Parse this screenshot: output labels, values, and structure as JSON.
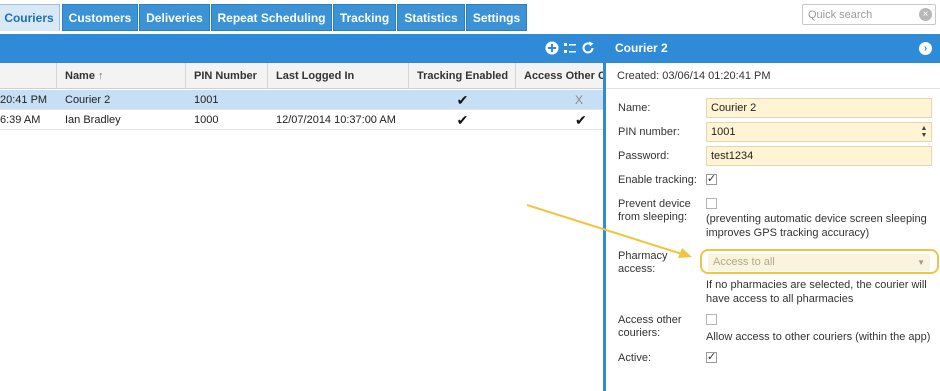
{
  "tabs": [
    {
      "label": "Couriers",
      "active": true
    },
    {
      "label": "Customers",
      "active": false
    },
    {
      "label": "Deliveries",
      "active": false
    },
    {
      "label": "Repeat Scheduling",
      "active": false
    },
    {
      "label": "Tracking",
      "active": false
    },
    {
      "label": "Statistics",
      "active": false
    },
    {
      "label": "Settings",
      "active": false
    }
  ],
  "search": {
    "placeholder": "Quick search"
  },
  "grid": {
    "columns": [
      "Name",
      "PIN Number",
      "Last Logged In",
      "Tracking Enabled",
      "Access Other C"
    ],
    "sort_icon": "arrow-up-icon",
    "rows": [
      {
        "time": "20:41 PM",
        "name": "Courier 2",
        "pin": "1001",
        "last_login": "",
        "tracking": true,
        "access_other": false
      },
      {
        "time": "6:39 AM",
        "name": "Ian Bradley",
        "pin": "1000",
        "last_login": "12/07/2014 10:37:00 AM",
        "tracking": true,
        "access_other": true
      }
    ]
  },
  "panel": {
    "title": "Courier 2",
    "created": "Created: 03/06/14 01:20:41 PM",
    "name_label": "Name:",
    "name_value": "Courier 2",
    "pin_label": "PIN number:",
    "pin_value": "1001",
    "password_label": "Password:",
    "password_value": "test1234",
    "tracking_label": "Enable tracking:",
    "prevent_label_1": "Prevent device",
    "prevent_label_2": "from sleeping:",
    "prevent_help_1": "(preventing automatic device screen sleeping",
    "prevent_help_2": "improves GPS tracking accuracy)",
    "pharmacy_label_1": "Pharmacy",
    "pharmacy_label_2": "access:",
    "pharmacy_value": "Access to all",
    "pharmacy_help_1": "If no pharmacies are selected, the courier will",
    "pharmacy_help_2": "have access to all pharmacies",
    "access_label_1": "Access other",
    "access_label_2": "couriers:",
    "access_help": "Allow access to other couriers (within the app)",
    "active_label": "Active:"
  },
  "colors": {
    "accent": "#2f8ad8",
    "field_bg": "#fff5d4",
    "highlight": "#f0c541",
    "selected_row": "#c7dff4"
  }
}
